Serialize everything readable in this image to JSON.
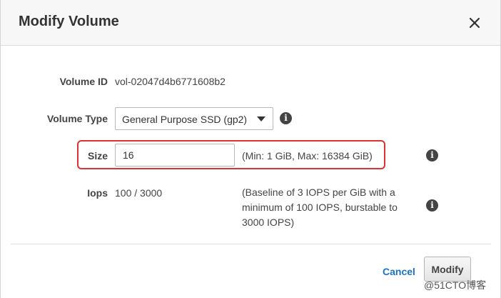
{
  "dialog": {
    "title": "Modify Volume",
    "close_icon": "close-icon"
  },
  "fields": {
    "volume_id": {
      "label": "Volume ID",
      "value": "vol-02047d4b6771608b2"
    },
    "volume_type": {
      "label": "Volume Type",
      "selected": "General Purpose SSD (gp2)"
    },
    "size": {
      "label": "Size",
      "value": "16",
      "note": "(Min: 1 GiB, Max: 16384 GiB)"
    },
    "iops": {
      "label": "Iops",
      "value": "100 / 3000",
      "note_line1": "(Baseline of 3 IOPS per GiB with a",
      "note_line2": "minimum of 100 IOPS, burstable to",
      "note_line3": "3000 IOPS)"
    }
  },
  "footer": {
    "cancel_label": "Cancel",
    "modify_label": "Modify"
  },
  "watermark": "@51CTO博客",
  "colors": {
    "highlight": "#e03131",
    "link": "#1a73c7"
  }
}
